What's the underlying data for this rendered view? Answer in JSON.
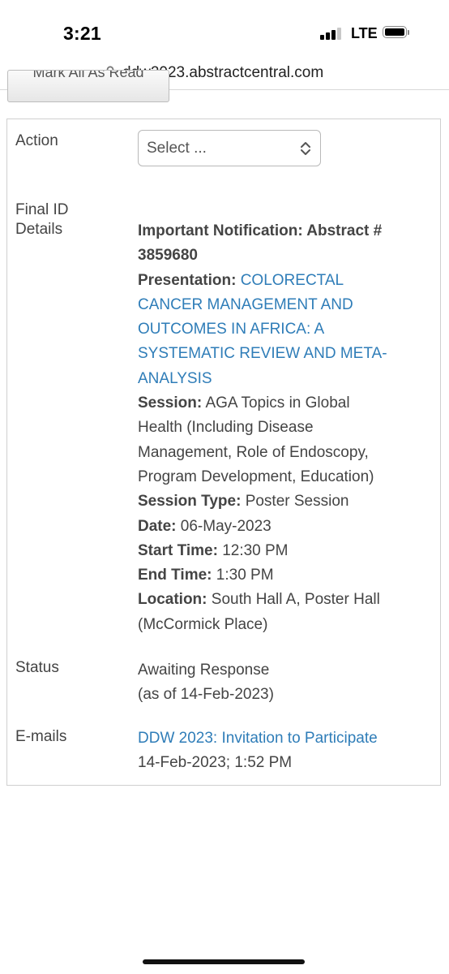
{
  "status_bar": {
    "time": "3:21",
    "network": "LTE",
    "battery_icon": "battery-full-icon",
    "signal_icon": "cellular-signal-icon"
  },
  "browser": {
    "url": "ddw2023.abstractcentral.com",
    "lock_icon": "lock-icon"
  },
  "toolbar": {
    "mark_all_read_label": "Mark All As Read"
  },
  "details": {
    "action": {
      "label": "Action",
      "select_value": "Select ...",
      "select_icon": "chevron-updown-icon"
    },
    "final_id": {
      "label_line1": "Final ID",
      "label_line2": "Details",
      "notification_heading": "Important Notification: Abstract #",
      "abstract_number": "3859680",
      "presentation_label": "Presentation:",
      "presentation_title_lines": [
        "COLORECTAL",
        "CANCER MANAGEMENT AND",
        "OUTCOMES IN AFRICA: A",
        "SYSTEMATIC REVIEW AND META-",
        "ANALYSIS"
      ],
      "session_label": "Session:",
      "session_lines": [
        "AGA Topics in Global",
        "Health (Including Disease",
        "Management, Role of Endoscopy,",
        "Program Development, Education)"
      ],
      "session_type_label": "Session Type:",
      "session_type": "Poster Session",
      "date_label": "Date:",
      "date": "06-May-2023",
      "start_time_label": "Start Time:",
      "start_time": "12:30 PM",
      "end_time_label": "End Time:",
      "end_time": "1:30 PM",
      "location_label": "Location:",
      "location_line1": "South Hall A, Poster Hall",
      "location_line2": "(McCormick Place)"
    },
    "status": {
      "label": "Status",
      "value": "Awaiting Response",
      "as_of": "(as of 14-Feb-2023)"
    },
    "emails": {
      "label": "E-mails",
      "link_text": "DDW 2023: Invitation to Participate",
      "timestamp": "14-Feb-2023; 1:52 PM"
    }
  },
  "colors": {
    "link": "#2f7db8",
    "text": "#444444",
    "border": "#cfcfcf"
  }
}
